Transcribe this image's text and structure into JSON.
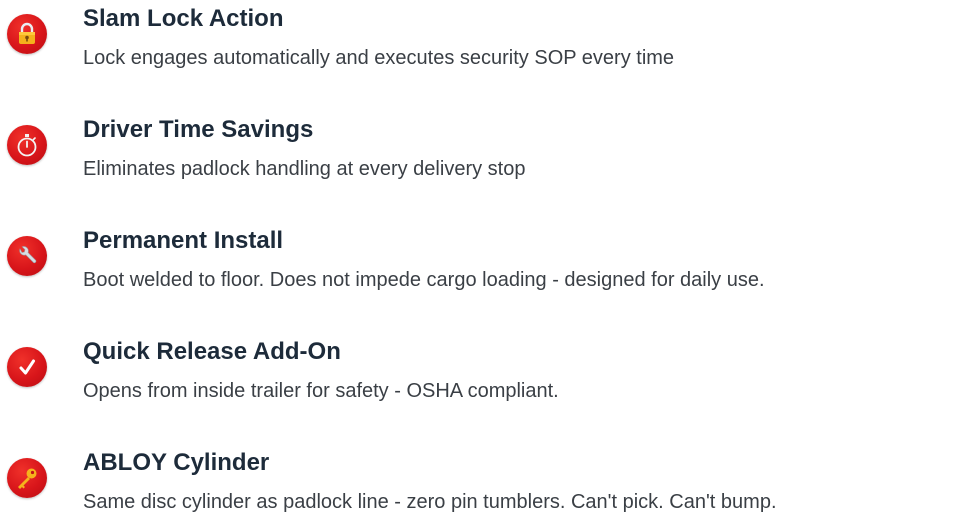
{
  "features": [
    {
      "icon": "padlock-icon",
      "title": "Slam Lock Action",
      "description": "Lock engages automatically and executes security SOP every time"
    },
    {
      "icon": "stopwatch-icon",
      "title": "Driver Time Savings",
      "description": "Eliminates padlock handling at every delivery stop"
    },
    {
      "icon": "wrench-icon",
      "title": "Permanent Install",
      "description": "Boot welded to floor. Does not impede cargo loading - designed for daily use."
    },
    {
      "icon": "checkmark-icon",
      "title": "Quick Release Add-On",
      "description": "Opens from inside trailer for safety - OSHA compliant."
    },
    {
      "icon": "key-icon",
      "title": "ABLOY Cylinder",
      "description": "Same disc cylinder as padlock line - zero pin tumblers. Can't pick. Can't bump."
    }
  ],
  "colors": {
    "icon_background": "#d8151a",
    "title_text": "#1d2b3a",
    "description_text": "#3a3f45"
  }
}
